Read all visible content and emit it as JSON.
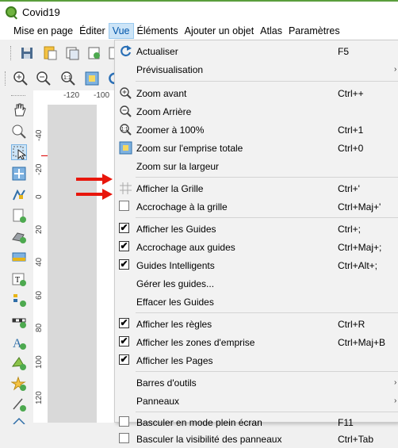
{
  "window": {
    "title": "Covid19"
  },
  "menubar": {
    "items": [
      "Mise en page",
      "Éditer",
      "Vue",
      "Éléments",
      "Ajouter un objet",
      "Atlas",
      "Paramètres"
    ],
    "active": "Vue"
  },
  "rulers": {
    "h_ticks": [
      "-120",
      "-100"
    ],
    "v_ticks": [
      "-40",
      "-20",
      "0",
      "20",
      "40",
      "60",
      "80",
      "100",
      "120"
    ]
  },
  "vue_menu": {
    "items": [
      {
        "label": "Actualiser",
        "shortcut": "F5",
        "icon": "refresh-icon"
      },
      {
        "label": "Prévisualisation",
        "shortcut": "",
        "submenu": "›"
      },
      {
        "label": "Zoom avant",
        "shortcut": "Ctrl++",
        "icon": "zoom-in-icon"
      },
      {
        "label": "Zoom Arrière",
        "shortcut": "",
        "icon": "zoom-out-icon"
      },
      {
        "label": "Zoomer à 100%",
        "shortcut": "Ctrl+1",
        "icon": "zoom-actual-icon"
      },
      {
        "label": "Zoom sur l'emprise totale",
        "shortcut": "Ctrl+0",
        "icon": "zoom-full-icon"
      },
      {
        "label": "Zoom sur la largeur",
        "shortcut": ""
      },
      {
        "label": "Afficher la Grille",
        "shortcut": "Ctrl+'",
        "icon": "grid-icon"
      },
      {
        "label": "Accrochage à la grille",
        "shortcut": "Ctrl+Maj+'",
        "checked": false
      },
      {
        "label": "Afficher les Guides",
        "shortcut": "Ctrl+;",
        "checked": true
      },
      {
        "label": "Accrochage aux guides",
        "shortcut": "Ctrl+Maj+;",
        "checked": true
      },
      {
        "label": "Guides Intelligents",
        "shortcut": "Ctrl+Alt+;",
        "checked": true
      },
      {
        "label": "Gérer les guides...",
        "shortcut": ""
      },
      {
        "label": "Effacer les Guides",
        "shortcut": ""
      },
      {
        "label": "Afficher les règles",
        "shortcut": "Ctrl+R",
        "checked": true
      },
      {
        "label": "Afficher les zones d'emprise",
        "shortcut": "Ctrl+Maj+B",
        "checked": true
      },
      {
        "label": "Afficher les Pages",
        "shortcut": "",
        "checked": true
      },
      {
        "label": "Barres d'outils",
        "shortcut": "",
        "submenu": "›"
      },
      {
        "label": "Panneaux",
        "shortcut": "",
        "submenu": "›"
      },
      {
        "label": "Basculer en mode plein écran",
        "shortcut": "F11",
        "checked": false
      },
      {
        "label": "Basculer la visibilité des panneaux",
        "shortcut": "Ctrl+Tab",
        "checked": false
      }
    ],
    "check_mark": "✔"
  },
  "colors": {
    "accent": "#0055aa",
    "arrow": "#e8160c",
    "qgis_green": "#6fb33f"
  }
}
